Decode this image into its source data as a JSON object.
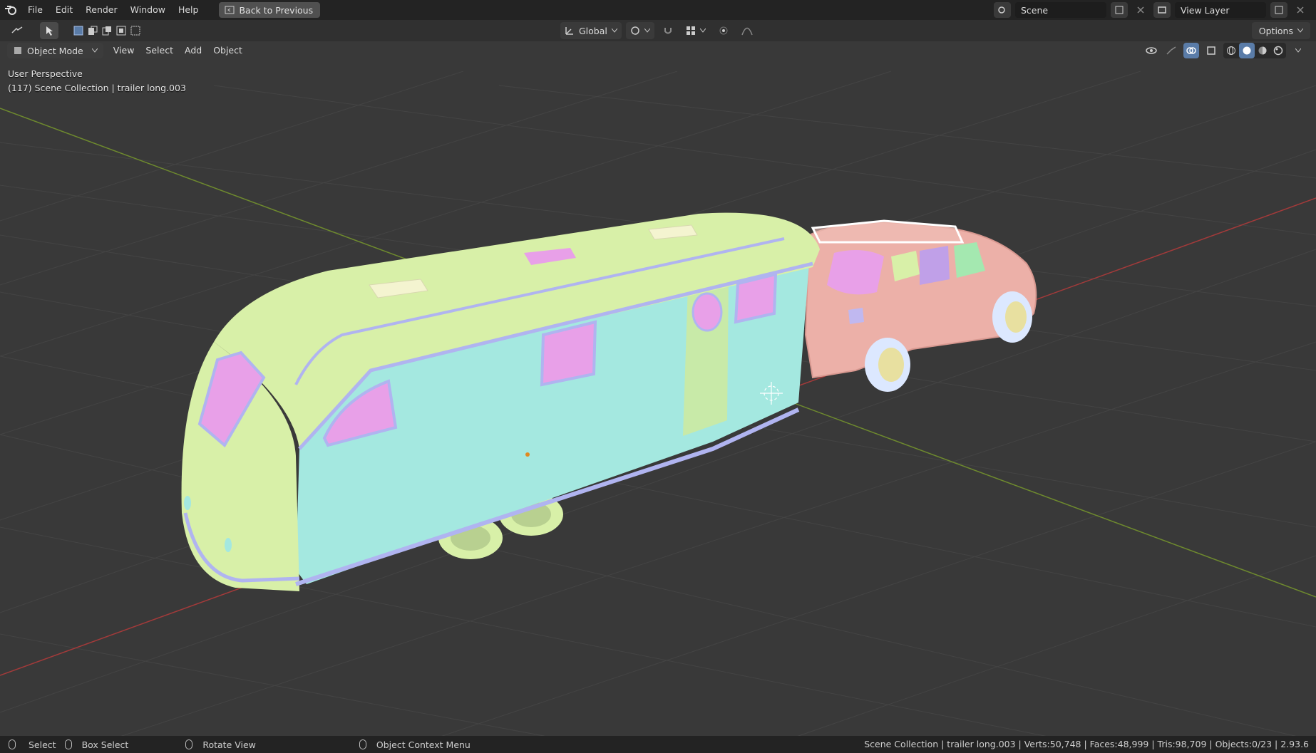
{
  "topbar": {
    "menus": [
      "File",
      "Edit",
      "Render",
      "Window",
      "Help"
    ],
    "back_button": "Back to Previous",
    "scene_label": "Scene",
    "view_layer_label": "View Layer"
  },
  "toolheader": {
    "orientation": "Global",
    "options": "Options"
  },
  "vpheader": {
    "mode": "Object Mode",
    "menus": [
      "View",
      "Select",
      "Add",
      "Object"
    ]
  },
  "overlay": {
    "perspective": "User Perspective",
    "collection": "(117) Scene Collection | trailer long.003"
  },
  "statusbar": {
    "select": "Select",
    "box_select": "Box Select",
    "rotate": "Rotate View",
    "context_menu": "Object Context Menu",
    "stats": "Scene Collection | trailer long.003 | Verts:50,748 | Faces:48,999 | Tris:98,709 | Objects:0/23 | 2.93.6"
  },
  "colors": {
    "trailer_top": "#d8f0a8",
    "trailer_side": "#a4e8e0",
    "window_pink": "#e8a0e8",
    "trim_blue": "#b0b4f0",
    "car_body": "#ecb0a8",
    "axis_x": "#a33a3a",
    "axis_y": "#6e8a2e"
  }
}
